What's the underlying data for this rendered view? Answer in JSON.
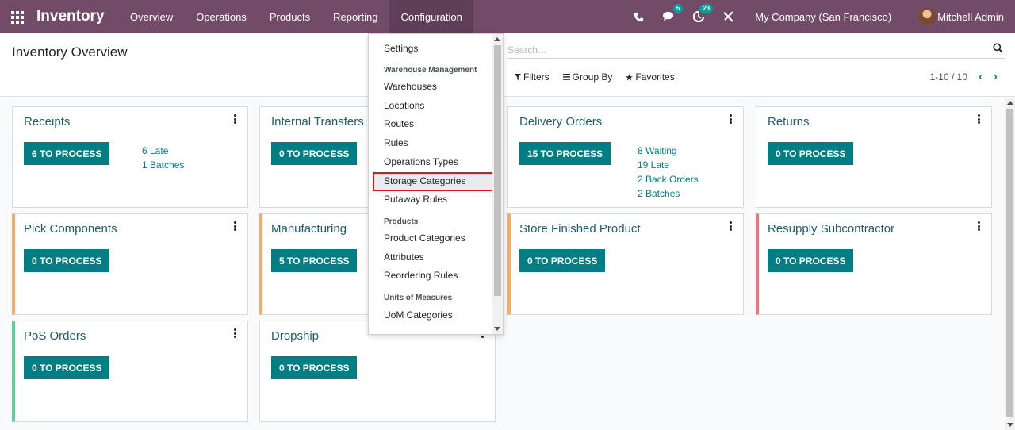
{
  "navbar": {
    "app_name": "Inventory",
    "menu": [
      "Overview",
      "Operations",
      "Products",
      "Reporting",
      "Configuration"
    ],
    "active_menu": "Configuration",
    "messages_badge": "5",
    "activities_badge": "23",
    "company": "My Company (San Francisco)",
    "user": "Mitchell Admin"
  },
  "control_panel": {
    "title": "Inventory Overview",
    "search_placeholder": "Search...",
    "filters": "Filters",
    "group_by": "Group By",
    "favorites": "Favorites",
    "pager": "1-10 / 10"
  },
  "cards": [
    {
      "title": "Receipts",
      "button": "6 TO PROCESS",
      "stats": [
        "6 Late",
        "1 Batches"
      ]
    },
    {
      "title": "Internal Transfers",
      "button": "0 TO PROCESS",
      "stats": []
    },
    {
      "title": "Delivery Orders",
      "button": "15 TO PROCESS",
      "stats": [
        "8 Waiting",
        "19 Late",
        "2 Back Orders",
        "2 Batches"
      ]
    },
    {
      "title": "Returns",
      "button": "0 TO PROCESS",
      "stats": []
    },
    {
      "title": "Pick Components",
      "button": "0 TO PROCESS",
      "stats": []
    },
    {
      "title": "Manufacturing",
      "button": "5 TO PROCESS",
      "stats": []
    },
    {
      "title": "Store Finished Product",
      "button": "0 TO PROCESS",
      "stats": []
    },
    {
      "title": "Resupply Subcontractor",
      "button": "0 TO PROCESS",
      "stats": []
    },
    {
      "title": "PoS Orders",
      "button": "0 TO PROCESS",
      "stats": []
    },
    {
      "title": "Dropship",
      "button": "0 TO PROCESS",
      "stats": []
    }
  ],
  "config_dropdown": {
    "settings": "Settings",
    "warehouse_header": "Warehouse Management",
    "warehouses": "Warehouses",
    "locations": "Locations",
    "routes": "Routes",
    "rules": "Rules",
    "operations_types": "Operations Types",
    "storage_categories": "Storage Categories",
    "putaway_rules": "Putaway Rules",
    "products_header": "Products",
    "product_categories": "Product Categories",
    "attributes": "Attributes",
    "reordering_rules": "Reordering Rules",
    "uom_header": "Units of Measures",
    "uom_categories": "UoM Categories"
  },
  "colors": {
    "navbar": "#714b67",
    "accent": "#017e84",
    "highlight_border": "#e0141e"
  }
}
